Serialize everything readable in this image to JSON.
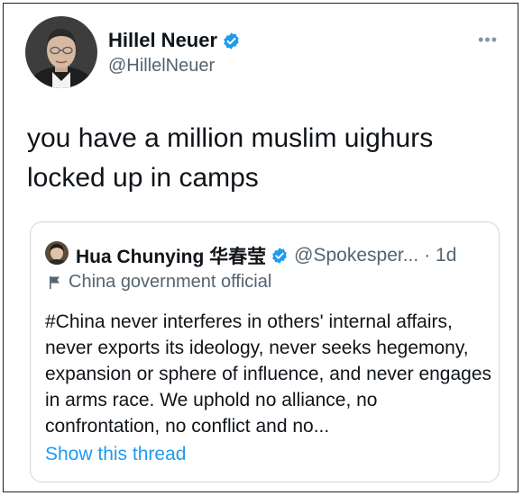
{
  "author": {
    "name": "Hillel Neuer",
    "handle": "@HillelNeuer"
  },
  "more_label": "•••",
  "tweet_text": "you have a million muslim uighurs locked up in camps",
  "quoted": {
    "name": "Hua Chunying 华春莹",
    "handle": "@Spokesper...",
    "time": "· 1d",
    "label": "China government official",
    "text": "#China never interferes in others' internal affairs, never exports its ideology, never seeks hegemony, expansion or sphere of influence, and never engages in arms race. We uphold no alliance, no confrontation, no conflict and no...",
    "show_thread": "Show this thread"
  },
  "colors": {
    "verified": "#1d9bf0",
    "link": "#1d9bf0",
    "secondary_text": "#536471",
    "border": "#cfd9de"
  },
  "icons": {
    "verified": "verified-badge-icon",
    "more": "more-horizontal-icon",
    "government_label": "flag-icon"
  }
}
